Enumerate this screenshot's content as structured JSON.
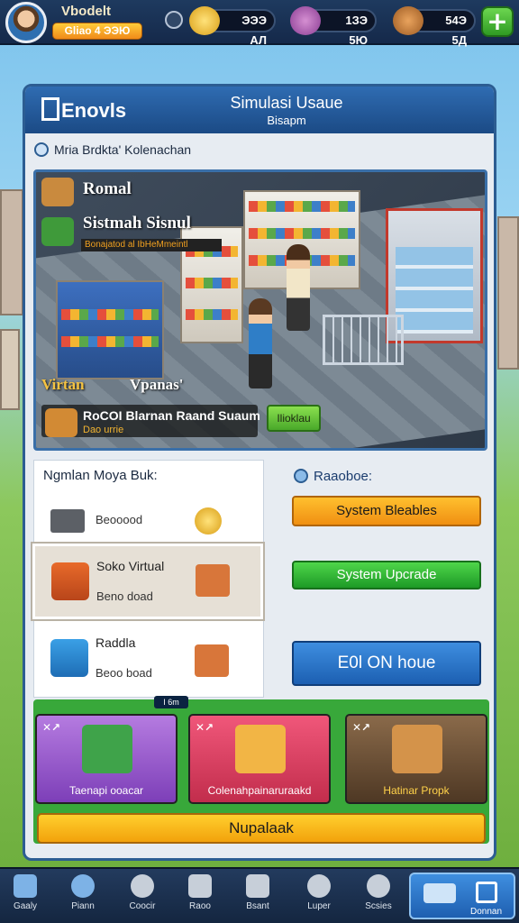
{
  "player": {
    "name": "Vbodelt",
    "badge": "Gliao 4 ЭЭЮ"
  },
  "resources": [
    {
      "icon": "gold-bar-icon",
      "value": "ЭЭЭ АЛ"
    },
    {
      "icon": "potion-icon",
      "value": "1ЗЭ 5Ю"
    },
    {
      "icon": "bread-icon",
      "value": "54Э 5Д"
    }
  ],
  "panel": {
    "brand": "Enovls",
    "title": "Simulasi Usaue",
    "subtitle": "Bisapm",
    "subline": "Mria Brdkta' Kolenachan"
  },
  "scene": {
    "label1": "Romal",
    "label2": "Sistmah Sisnul",
    "label2_sub": "Bonajatod al IbHeMmeintl",
    "label3": "Virtan",
    "label3b": "Vpanas'",
    "strip_title": "RoCOI Blarnan Raand Suaum",
    "strip_sub": "Dao urrie",
    "button": "Ilioklau"
  },
  "list": {
    "title": "Ngmlan Moya Buk:",
    "items": [
      {
        "name": "",
        "sub": "Beooood"
      },
      {
        "name": "Soko Virtual",
        "sub": "Beno doad"
      },
      {
        "name": "Raddla",
        "sub": "Beoo boad"
      }
    ]
  },
  "right": {
    "title": "Raaoboe:",
    "btn_orange": "System Bleables",
    "btn_green": "System Upcrade",
    "btn_blue": "E0l ON houe"
  },
  "categories": {
    "tab": "I 6m",
    "items": [
      {
        "label": "Taenapi ooacar",
        "mark": "✕↗"
      },
      {
        "label": "Colenahpainaruraakd",
        "mark": "✕↗"
      },
      {
        "label": "Hatinar Propk",
        "mark": "✕↗"
      }
    ],
    "main_action": "Nupalaak"
  },
  "nav": [
    {
      "label": "Gaaly",
      "icon": "home-icon"
    },
    {
      "label": "Piann",
      "icon": "search-icon"
    },
    {
      "label": "Coocir",
      "icon": "globe-icon"
    },
    {
      "label": "Raoo",
      "icon": "calendar-icon"
    },
    {
      "label": "Bsant",
      "icon": "hammer-icon"
    },
    {
      "label": "Luper",
      "icon": "clock-icon"
    },
    {
      "label": "Scsies",
      "icon": "gear-icon"
    }
  ],
  "nav_highlight": {
    "label": "Donnan"
  },
  "colors": {
    "primary": "#2c5d92",
    "accent": "#f2a20b",
    "green": "#38a83a"
  }
}
